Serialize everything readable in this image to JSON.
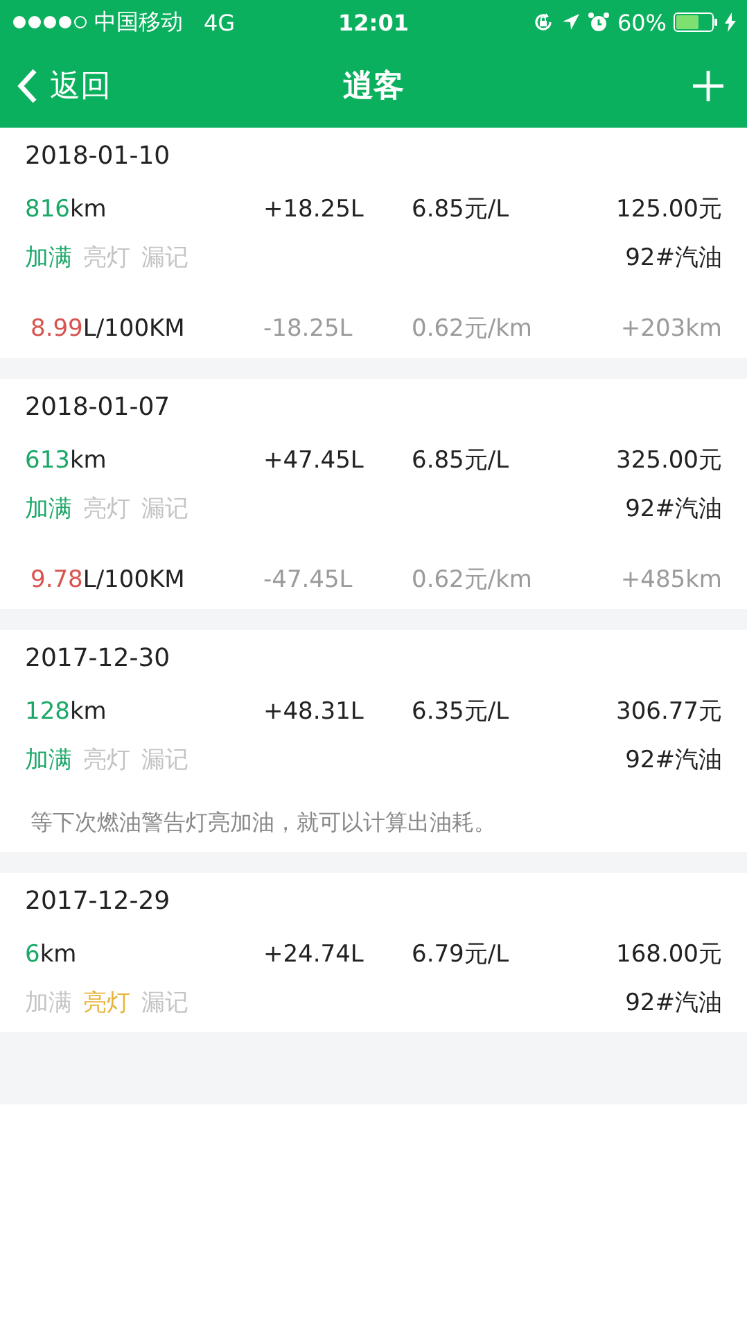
{
  "status_bar": {
    "carrier": "中国移动",
    "network": "4G",
    "time": "12:01",
    "battery": "60%"
  },
  "nav": {
    "back": "返回",
    "title": "逍客"
  },
  "records": [
    {
      "date": "2018-01-10",
      "distance": {
        "value": "816",
        "unit": "km"
      },
      "fuel_added": "+18.25L",
      "unit_price": "6.85元/L",
      "amount": "125.00元",
      "flags": [
        {
          "kind": "full",
          "label": "加满",
          "on": true
        },
        {
          "kind": "light",
          "label": "亮灯",
          "on": false
        },
        {
          "kind": "missed",
          "label": "漏记",
          "on": false
        }
      ],
      "fuel_grade": "92#汽油",
      "footer": {
        "kind": "stats",
        "consumption": {
          "value": "8.99",
          "unit": "L/100KM"
        },
        "fuel_used": "-18.25L",
        "cost_per_km": "0.62元/km",
        "distance_since": "+203km"
      }
    },
    {
      "date": "2018-01-07",
      "distance": {
        "value": "613",
        "unit": "km"
      },
      "fuel_added": "+47.45L",
      "unit_price": "6.85元/L",
      "amount": "325.00元",
      "flags": [
        {
          "kind": "full",
          "label": "加满",
          "on": true
        },
        {
          "kind": "light",
          "label": "亮灯",
          "on": false
        },
        {
          "kind": "missed",
          "label": "漏记",
          "on": false
        }
      ],
      "fuel_grade": "92#汽油",
      "footer": {
        "kind": "stats",
        "consumption": {
          "value": "9.78",
          "unit": "L/100KM"
        },
        "fuel_used": "-47.45L",
        "cost_per_km": "0.62元/km",
        "distance_since": "+485km"
      }
    },
    {
      "date": "2017-12-30",
      "distance": {
        "value": "128",
        "unit": "km"
      },
      "fuel_added": "+48.31L",
      "unit_price": "6.35元/L",
      "amount": "306.77元",
      "flags": [
        {
          "kind": "full",
          "label": "加满",
          "on": true
        },
        {
          "kind": "light",
          "label": "亮灯",
          "on": false
        },
        {
          "kind": "missed",
          "label": "漏记",
          "on": false
        }
      ],
      "fuel_grade": "92#汽油",
      "footer": {
        "kind": "note",
        "text": "等下次燃油警告灯亮加油，就可以计算出油耗。"
      }
    },
    {
      "date": "2017-12-29",
      "distance": {
        "value": "6",
        "unit": "km"
      },
      "fuel_added": "+24.74L",
      "unit_price": "6.79元/L",
      "amount": "168.00元",
      "flags": [
        {
          "kind": "full",
          "label": "加满",
          "on": false
        },
        {
          "kind": "light",
          "label": "亮灯",
          "on": true
        },
        {
          "kind": "missed",
          "label": "漏记",
          "on": false
        }
      ],
      "fuel_grade": "92#汽油"
    }
  ]
}
